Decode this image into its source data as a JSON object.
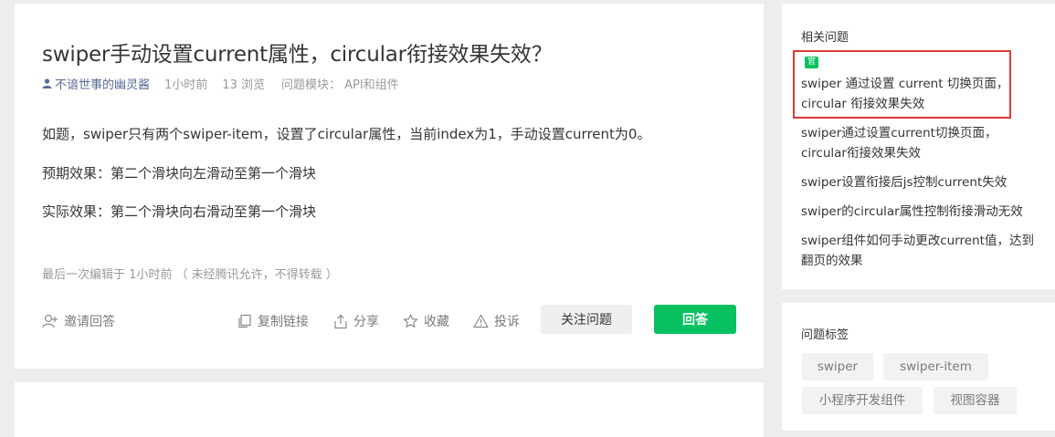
{
  "question": {
    "title": "swiper手动设置current属性，circular衔接效果失效？",
    "author": "不谙世事的幽灵酱",
    "time": "1小时前",
    "views": "13 浏览",
    "module": "问题模块： API和组件",
    "paragraphs": [
      "如题，swiper只有两个swiper-item，设置了circular属性，当前index为1，手动设置current为0。",
      "预期效果：第二个滑块向左滑动至第一个滑块",
      "实际效果：第二个滑块向右滑动至第一个滑块"
    ],
    "edited_note": "最后一次编辑于  1小时前  （ 未经腾讯允许，不得转载 ）"
  },
  "actions": {
    "invite": "邀请回答",
    "copy_link": "复制链接",
    "share": "分享",
    "favorite": "收藏",
    "report": "投诉",
    "follow": "关注问题",
    "answer": "回答"
  },
  "related": {
    "title": "相关问题",
    "official_badge": "官",
    "items": [
      "swiper 通过设置 current 切换页面，circular 衔接效果失效",
      "swiper通过设置current切换页面，circular衔接效果失效",
      "swiper设置衔接后js控制current失效",
      "swiper的circular属性控制衔接滑动无效",
      "swiper组件如何手动更改current值，达到翻页的效果"
    ]
  },
  "tags": {
    "title": "问题标签",
    "items": [
      "swiper",
      "swiper-item",
      "小程序开发组件",
      "视图容器"
    ]
  },
  "colors": {
    "accent_green": "#07c160",
    "link_blue": "#576b95",
    "highlight_red": "#e53935"
  }
}
